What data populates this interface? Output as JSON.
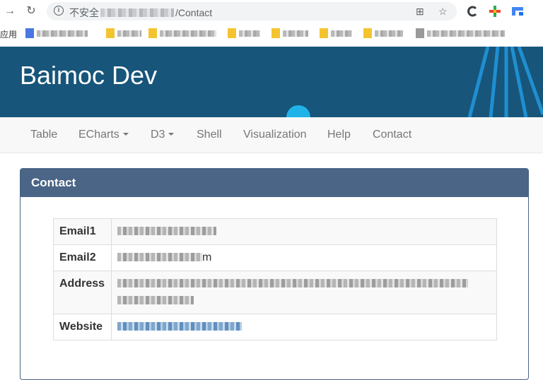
{
  "browser": {
    "security_label": "不安全",
    "url_path": "/Contact",
    "bookmarks_label": "应用"
  },
  "site": {
    "brand": "Baimoc Dev"
  },
  "nav": {
    "items": [
      {
        "label": "Table"
      },
      {
        "label": "ECharts"
      },
      {
        "label": "D3"
      },
      {
        "label": "Shell"
      },
      {
        "label": "Visualization"
      },
      {
        "label": "Help"
      },
      {
        "label": "Contact"
      }
    ]
  },
  "contact": {
    "panel_title": "Contact",
    "rows": [
      {
        "key": "Email1",
        "value_tail": ""
      },
      {
        "key": "Email2",
        "value_tail": "m"
      },
      {
        "key": "Address",
        "value_tail": ""
      },
      {
        "key": "Website",
        "value_tail": ""
      }
    ]
  },
  "colors": {
    "header": "#17557a",
    "panel_heading": "#4a6585",
    "navbar_bg": "#f8f8f8",
    "nav_text": "#777777"
  }
}
